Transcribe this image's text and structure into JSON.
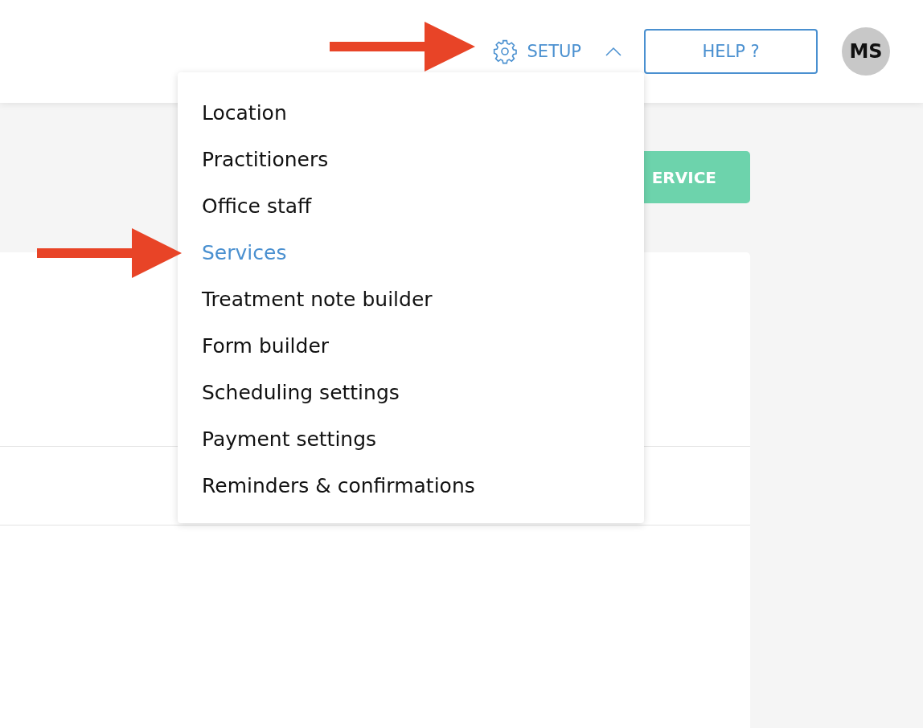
{
  "header": {
    "setup": {
      "label": "SETUP",
      "expanded": true
    },
    "help_button": "HELP ?",
    "avatar": "MS"
  },
  "setup_menu": [
    {
      "label": "Location",
      "selected": false
    },
    {
      "label": "Practitioners",
      "selected": false
    },
    {
      "label": "Office staff",
      "selected": false
    },
    {
      "label": "Services",
      "selected": true
    },
    {
      "label": "Treatment note builder",
      "selected": false
    },
    {
      "label": "Form builder",
      "selected": false
    },
    {
      "label": "Scheduling settings",
      "selected": false
    },
    {
      "label": "Payment settings",
      "selected": false
    },
    {
      "label": "Reminders & confirmations",
      "selected": false
    }
  ],
  "add_button": "ERVICE"
}
